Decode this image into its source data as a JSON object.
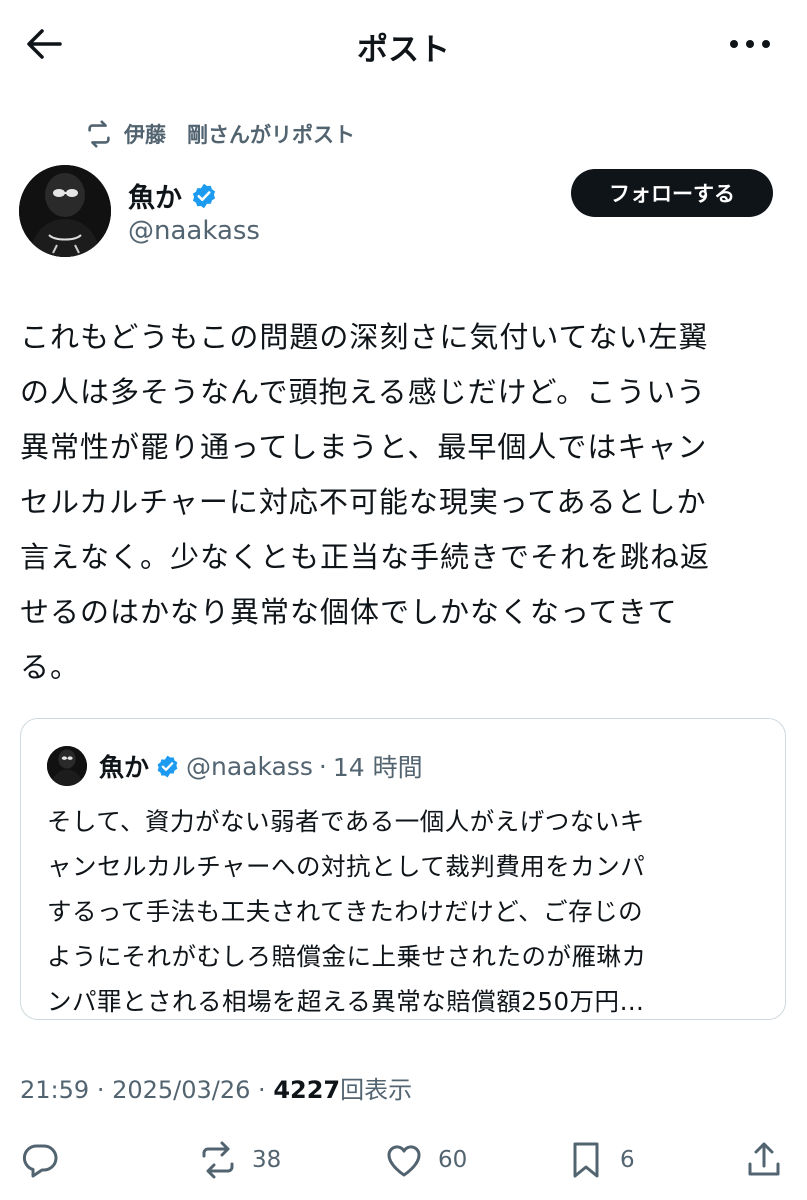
{
  "header": {
    "title": "ポスト"
  },
  "repost": {
    "label": "伊藤　剛さんがリポスト"
  },
  "author": {
    "name": "魚か",
    "handle": "@naakass",
    "follow_label": "フォローする",
    "verified_color": "#1d9bf0"
  },
  "post": {
    "text": "これもどうもこの問題の深刻さに気付いてない左翼\nの人は多そうなんで頭抱える感じだけど。こういう\n異常性が罷り通ってしまうと、最早個人ではキャン\nセルカルチャーに対応不可能な現実ってあるとしか\n言えなく。少なくとも正当な手続きでそれを跳ね返\nせるのはかなり異常な個体でしかなくなってきて\nる。"
  },
  "quote": {
    "name": "魚か",
    "handle": "@naakass",
    "time": "14 時間",
    "text": "そして、資力がない弱者である一個人がえげつないキ\nャンセルカルチャーへの対抗として裁判費用をカンパ\nするって手法も工夫されてきたわけだけど、ご存じの\nようにそれがむしろ賠償金に上乗せされたのが雁琳カ\nンパ罪とされる相場を超える異常な賠償額250万円…"
  },
  "meta": {
    "time": "21:59",
    "date": "2025/03/26",
    "views": "4227",
    "views_label": "回表示"
  },
  "actions": {
    "retweets": "38",
    "likes": "60",
    "bookmarks": "6"
  }
}
